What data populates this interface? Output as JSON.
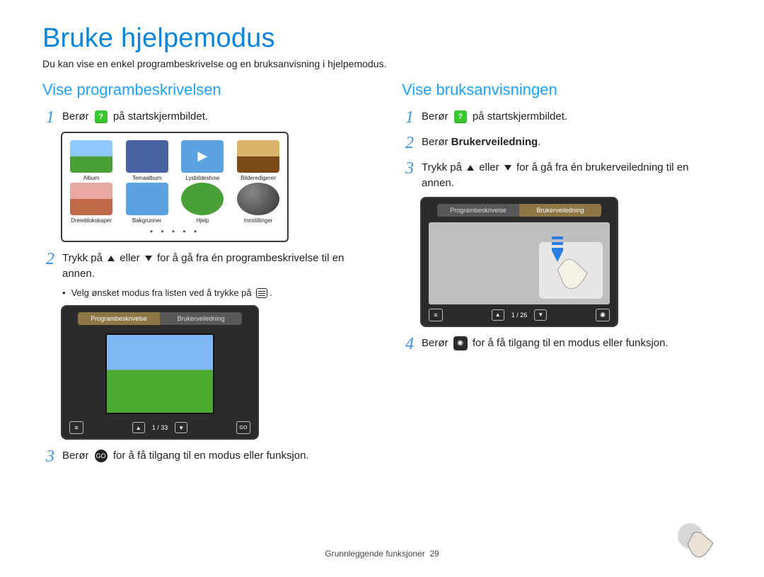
{
  "title": "Bruke hjelpemodus",
  "intro": "Du kan vise en enkel programbeskrivelse og en bruksanvisning i hjelpemodus.",
  "footer_section": "Grunnleggende funksjoner",
  "footer_page": "29",
  "icons": {
    "help": "?",
    "menu": "≡",
    "go": "GO",
    "camera": "📷"
  },
  "left": {
    "heading": "Vise programbeskrivelsen",
    "step1a": "Berør",
    "step1b": "på startskjermbildet.",
    "grid_captions": [
      "Album",
      "Temaalbum",
      "Lysbildeshow",
      "Bilderedigerer",
      "Dreieblokskaper",
      "Bakgrunner",
      "Hjelp",
      "Innstillinger"
    ],
    "step2a": "Trykk på",
    "step2b": "eller",
    "step2c": "for å gå fra én programbeskrivelse til en annen.",
    "bullet": "Velg ønsket modus fra listen ved å trykke på",
    "device_tabs": {
      "active": "Programbeskrivelse",
      "inactive": "Brukerveiledning"
    },
    "counter": "1 / 33",
    "step3a": "Berør",
    "step3b": "for å få tilgang til en modus eller funksjon."
  },
  "right": {
    "heading": "Vise bruksanvisningen",
    "step1a": "Berør",
    "step1b": "på startskjermbildet.",
    "step2_full_a": "Berør ",
    "step2_full_b": "Brukerveiledning",
    "step2_full_c": ".",
    "step3a": "Trykk på",
    "step3b": "eller",
    "step3c": "for å gå fra én brukerveiledning til en annen.",
    "device_tabs": {
      "inactive": "Programbeskrivelse",
      "active": "Brukerveiledning"
    },
    "counter": "1 / 26",
    "step4a": "Berør",
    "step4b": "for å få tilgang til en modus eller funksjon."
  }
}
